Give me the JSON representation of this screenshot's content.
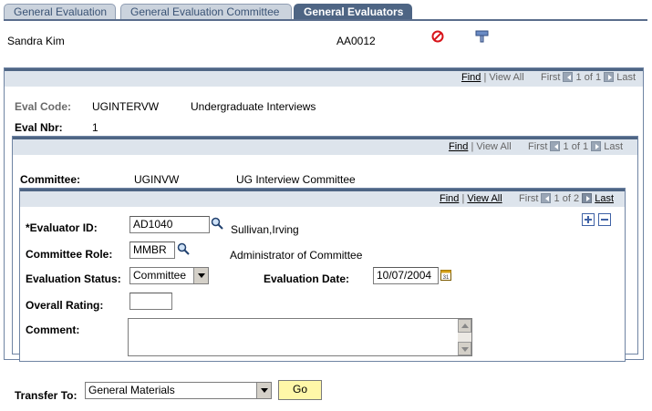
{
  "tabs": [
    {
      "label": "General Evaluation",
      "active": false
    },
    {
      "label": "General Evaluation Committee",
      "active": false
    },
    {
      "label": "General Evaluators",
      "active": true
    }
  ],
  "header": {
    "name": "Sandra Kim",
    "id": "AA0012"
  },
  "level1": {
    "nav": {
      "find": "Find",
      "view_all": "View All",
      "first": "First",
      "range": "1 of 1",
      "last": "Last"
    },
    "eval_code_label": "Eval Code:",
    "eval_code": "UGINTERVW",
    "eval_code_desc": "Undergraduate Interviews",
    "eval_nbr_label": "Eval Nbr:",
    "eval_nbr": "1"
  },
  "level2": {
    "nav": {
      "find": "Find",
      "view_all": "View All",
      "first": "First",
      "range": "1 of 1",
      "last": "Last"
    },
    "committee_label": "Committee:",
    "committee_code": "UGINVW",
    "committee_desc": "UG Interview Committee"
  },
  "level3": {
    "nav": {
      "find": "Find",
      "view_all": "View All",
      "first": "First",
      "range": "1 of 2",
      "last": "Last"
    },
    "evaluator_id_label": "*Evaluator ID:",
    "evaluator_id": "AD1040",
    "evaluator_name": "Sullivan,Irving",
    "committee_role_label": "Committee Role:",
    "committee_role": "MMBR",
    "committee_role_desc": "Administrator of Committee",
    "eval_status_label": "Evaluation Status:",
    "eval_status": "Committee",
    "eval_date_label": "Evaluation Date:",
    "eval_date": "10/07/2004",
    "overall_rating_label": "Overall Rating:",
    "overall_rating": "",
    "comment_label": "Comment:",
    "comment": ""
  },
  "footer": {
    "transfer_label": "Transfer To:",
    "transfer_value": "General Materials",
    "go_label": "Go"
  },
  "colors": {
    "bar": "#4e6584",
    "go_button": "#fff7a8",
    "link_blue": "#3f62a6"
  }
}
